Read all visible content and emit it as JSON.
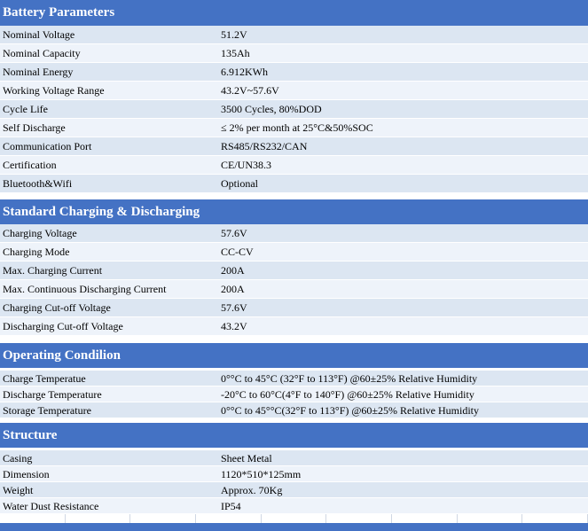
{
  "sections": [
    {
      "title": "Battery Parameters",
      "rows": [
        {
          "key": "Nominal Voltage",
          "value": "51.2V"
        },
        {
          "key": "Nominal Capacity",
          "value": "135Ah"
        },
        {
          "key": "Nominal Energy",
          "value": "6.912KWh"
        },
        {
          "key": "Working Voltage Range",
          "value": "43.2V~57.6V"
        },
        {
          "key": "Cycle Life",
          "value": "3500 Cycles, 80%DOD"
        },
        {
          "key": "Self Discharge",
          "value": "≤ 2% per month at 25°C&50%SOC"
        },
        {
          "key": "Communication Port",
          "value": "RS485/RS232/CAN"
        },
        {
          "key": "Certification",
          "value": "CE/UN38.3"
        },
        {
          "key": "Bluetooth&Wifi",
          "value": "Optional"
        }
      ]
    },
    {
      "title": "Standard Charging & Discharging",
      "rows": [
        {
          "key": "Charging Voltage",
          "value": "57.6V"
        },
        {
          "key": "Charging Mode",
          "value": "CC-CV"
        },
        {
          "key": "Max. Charging Current",
          "value": "200A"
        },
        {
          "key": "Max. Continuous Discharging Current",
          "value": "200A"
        },
        {
          "key": "Charging Cut-off Voltage",
          "value": "57.6V"
        },
        {
          "key": "Discharging Cut-off Voltage",
          "value": "43.2V"
        }
      ]
    },
    {
      "title": "Operating Condilion",
      "rows": [
        {
          "key": "Charge Temperatue",
          "value": "0°°C to 45°C (32°F to 113°F) @60±25% Relative Humidity"
        },
        {
          "key": "Discharge Temperature",
          "value": "-20°C to 60°C(4°F to 140°F) @60±25% Relative Humidity"
        },
        {
          "key": "Storage Temperature",
          "value": "0°°C to 45°°C(32°F to 113°F) @60±25% Relative Humidity"
        }
      ]
    },
    {
      "title": "Structure",
      "rows": [
        {
          "key": "Casing",
          "value": "Sheet Metal"
        },
        {
          "key": "Dimension",
          "value": "1120*510*125mm"
        },
        {
          "key": "Weight",
          "value": "Approx. 70Kg"
        },
        {
          "key": "Water Dust Resistance",
          "value": "IP54"
        }
      ]
    }
  ]
}
